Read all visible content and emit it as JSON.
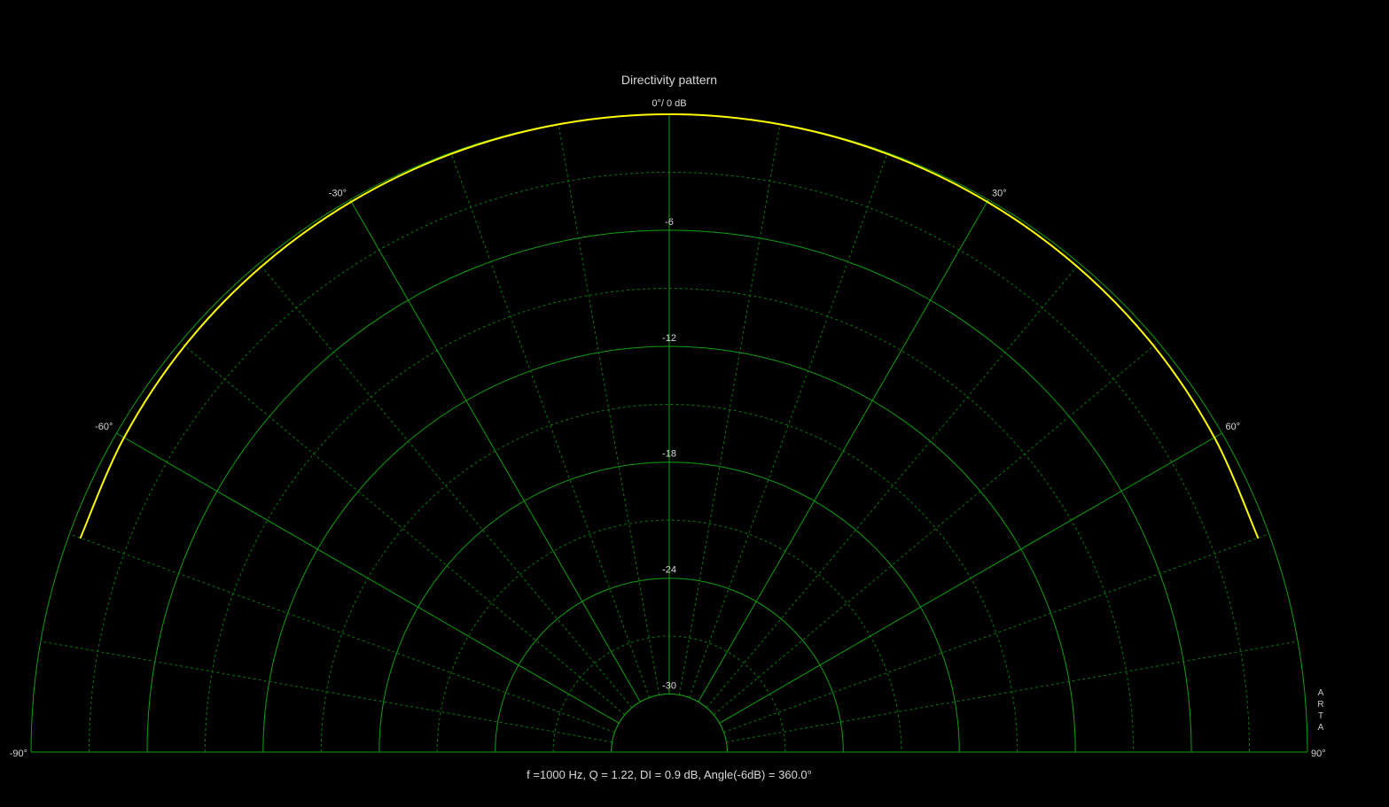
{
  "chart_data": {
    "type": "polar",
    "title": "Directivity pattern",
    "top_label": "0°/ 0 dB",
    "angle_range": [
      -90,
      90
    ],
    "db_range": [
      -33,
      0
    ],
    "db_rings": [
      0,
      -6,
      -12,
      -18,
      -24,
      -30
    ],
    "db_ring_labels": [
      "-6",
      "-12",
      "-18",
      "-24",
      "-30"
    ],
    "angle_ticks": [
      -90,
      -60,
      -30,
      0,
      30,
      60,
      90
    ],
    "angle_labels": [
      {
        "angle": -90,
        "text": "-90°"
      },
      {
        "angle": -60,
        "text": "-60°"
      },
      {
        "angle": -30,
        "text": "-30°"
      },
      {
        "angle": 30,
        "text": "30°"
      },
      {
        "angle": 60,
        "text": "60°"
      },
      {
        "angle": 90,
        "text": "90°"
      }
    ],
    "grid": true,
    "series": [
      {
        "color": "#ffff00",
        "points": [
          {
            "angle": -70,
            "db": -0.6
          },
          {
            "angle": -60,
            "db": -0.45
          },
          {
            "angle": -50,
            "db": -0.3
          },
          {
            "angle": -40,
            "db": -0.2
          },
          {
            "angle": -30,
            "db": -0.12
          },
          {
            "angle": -20,
            "db": -0.06
          },
          {
            "angle": -10,
            "db": -0.02
          },
          {
            "angle": 0,
            "db": 0
          },
          {
            "angle": 10,
            "db": -0.02
          },
          {
            "angle": 20,
            "db": -0.06
          },
          {
            "angle": 30,
            "db": -0.12
          },
          {
            "angle": 40,
            "db": -0.2
          },
          {
            "angle": 50,
            "db": -0.3
          },
          {
            "angle": 60,
            "db": -0.45
          },
          {
            "angle": 70,
            "db": -0.6
          }
        ]
      }
    ],
    "footer": "f =1000 Hz,  Q =  1.22,  DI =   0.9 dB,  Angle(-6dB) = 360.0°",
    "watermark": "ARTA"
  },
  "colors": {
    "background": "#000000",
    "grid_major": "#0fa00f",
    "grid_minor": "#0a780a",
    "curve": "#ffff00",
    "text": "#d8d8d8"
  }
}
